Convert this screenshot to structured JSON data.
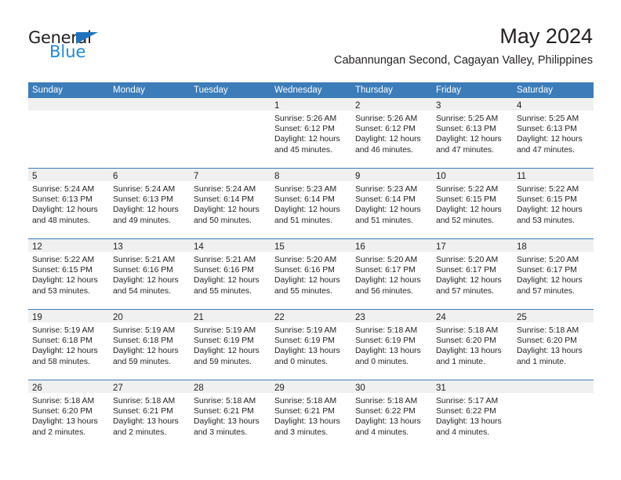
{
  "brand": {
    "name_top": "General",
    "name_bottom": "Blue",
    "triangle_color": "#1f72bd",
    "blue_color": "#1f88e0"
  },
  "header": {
    "title": "May 2024",
    "subtitle": "Cabannungan Second, Cagayan Valley, Philippines"
  },
  "theme": {
    "header_blue": "#3b7cb9",
    "day_band_gray": "#f0f0f0",
    "text_color": "#231f20"
  },
  "weekdays": [
    "Sunday",
    "Monday",
    "Tuesday",
    "Wednesday",
    "Thursday",
    "Friday",
    "Saturday"
  ],
  "weeks": [
    [
      {
        "day": "",
        "empty": true
      },
      {
        "day": "",
        "empty": true
      },
      {
        "day": "",
        "empty": true
      },
      {
        "day": "1",
        "sunrise": "Sunrise: 5:26 AM",
        "sunset": "Sunset: 6:12 PM",
        "daylight1": "Daylight: 12 hours",
        "daylight2": "and 45 minutes."
      },
      {
        "day": "2",
        "sunrise": "Sunrise: 5:26 AM",
        "sunset": "Sunset: 6:12 PM",
        "daylight1": "Daylight: 12 hours",
        "daylight2": "and 46 minutes."
      },
      {
        "day": "3",
        "sunrise": "Sunrise: 5:25 AM",
        "sunset": "Sunset: 6:13 PM",
        "daylight1": "Daylight: 12 hours",
        "daylight2": "and 47 minutes."
      },
      {
        "day": "4",
        "sunrise": "Sunrise: 5:25 AM",
        "sunset": "Sunset: 6:13 PM",
        "daylight1": "Daylight: 12 hours",
        "daylight2": "and 47 minutes."
      }
    ],
    [
      {
        "day": "5",
        "sunrise": "Sunrise: 5:24 AM",
        "sunset": "Sunset: 6:13 PM",
        "daylight1": "Daylight: 12 hours",
        "daylight2": "and 48 minutes."
      },
      {
        "day": "6",
        "sunrise": "Sunrise: 5:24 AM",
        "sunset": "Sunset: 6:13 PM",
        "daylight1": "Daylight: 12 hours",
        "daylight2": "and 49 minutes."
      },
      {
        "day": "7",
        "sunrise": "Sunrise: 5:24 AM",
        "sunset": "Sunset: 6:14 PM",
        "daylight1": "Daylight: 12 hours",
        "daylight2": "and 50 minutes."
      },
      {
        "day": "8",
        "sunrise": "Sunrise: 5:23 AM",
        "sunset": "Sunset: 6:14 PM",
        "daylight1": "Daylight: 12 hours",
        "daylight2": "and 51 minutes."
      },
      {
        "day": "9",
        "sunrise": "Sunrise: 5:23 AM",
        "sunset": "Sunset: 6:14 PM",
        "daylight1": "Daylight: 12 hours",
        "daylight2": "and 51 minutes."
      },
      {
        "day": "10",
        "sunrise": "Sunrise: 5:22 AM",
        "sunset": "Sunset: 6:15 PM",
        "daylight1": "Daylight: 12 hours",
        "daylight2": "and 52 minutes."
      },
      {
        "day": "11",
        "sunrise": "Sunrise: 5:22 AM",
        "sunset": "Sunset: 6:15 PM",
        "daylight1": "Daylight: 12 hours",
        "daylight2": "and 53 minutes."
      }
    ],
    [
      {
        "day": "12",
        "sunrise": "Sunrise: 5:22 AM",
        "sunset": "Sunset: 6:15 PM",
        "daylight1": "Daylight: 12 hours",
        "daylight2": "and 53 minutes."
      },
      {
        "day": "13",
        "sunrise": "Sunrise: 5:21 AM",
        "sunset": "Sunset: 6:16 PM",
        "daylight1": "Daylight: 12 hours",
        "daylight2": "and 54 minutes."
      },
      {
        "day": "14",
        "sunrise": "Sunrise: 5:21 AM",
        "sunset": "Sunset: 6:16 PM",
        "daylight1": "Daylight: 12 hours",
        "daylight2": "and 55 minutes."
      },
      {
        "day": "15",
        "sunrise": "Sunrise: 5:20 AM",
        "sunset": "Sunset: 6:16 PM",
        "daylight1": "Daylight: 12 hours",
        "daylight2": "and 55 minutes."
      },
      {
        "day": "16",
        "sunrise": "Sunrise: 5:20 AM",
        "sunset": "Sunset: 6:17 PM",
        "daylight1": "Daylight: 12 hours",
        "daylight2": "and 56 minutes."
      },
      {
        "day": "17",
        "sunrise": "Sunrise: 5:20 AM",
        "sunset": "Sunset: 6:17 PM",
        "daylight1": "Daylight: 12 hours",
        "daylight2": "and 57 minutes."
      },
      {
        "day": "18",
        "sunrise": "Sunrise: 5:20 AM",
        "sunset": "Sunset: 6:17 PM",
        "daylight1": "Daylight: 12 hours",
        "daylight2": "and 57 minutes."
      }
    ],
    [
      {
        "day": "19",
        "sunrise": "Sunrise: 5:19 AM",
        "sunset": "Sunset: 6:18 PM",
        "daylight1": "Daylight: 12 hours",
        "daylight2": "and 58 minutes."
      },
      {
        "day": "20",
        "sunrise": "Sunrise: 5:19 AM",
        "sunset": "Sunset: 6:18 PM",
        "daylight1": "Daylight: 12 hours",
        "daylight2": "and 59 minutes."
      },
      {
        "day": "21",
        "sunrise": "Sunrise: 5:19 AM",
        "sunset": "Sunset: 6:19 PM",
        "daylight1": "Daylight: 12 hours",
        "daylight2": "and 59 minutes."
      },
      {
        "day": "22",
        "sunrise": "Sunrise: 5:19 AM",
        "sunset": "Sunset: 6:19 PM",
        "daylight1": "Daylight: 13 hours",
        "daylight2": "and 0 minutes."
      },
      {
        "day": "23",
        "sunrise": "Sunrise: 5:18 AM",
        "sunset": "Sunset: 6:19 PM",
        "daylight1": "Daylight: 13 hours",
        "daylight2": "and 0 minutes."
      },
      {
        "day": "24",
        "sunrise": "Sunrise: 5:18 AM",
        "sunset": "Sunset: 6:20 PM",
        "daylight1": "Daylight: 13 hours",
        "daylight2": "and 1 minute."
      },
      {
        "day": "25",
        "sunrise": "Sunrise: 5:18 AM",
        "sunset": "Sunset: 6:20 PM",
        "daylight1": "Daylight: 13 hours",
        "daylight2": "and 1 minute."
      }
    ],
    [
      {
        "day": "26",
        "sunrise": "Sunrise: 5:18 AM",
        "sunset": "Sunset: 6:20 PM",
        "daylight1": "Daylight: 13 hours",
        "daylight2": "and 2 minutes."
      },
      {
        "day": "27",
        "sunrise": "Sunrise: 5:18 AM",
        "sunset": "Sunset: 6:21 PM",
        "daylight1": "Daylight: 13 hours",
        "daylight2": "and 2 minutes."
      },
      {
        "day": "28",
        "sunrise": "Sunrise: 5:18 AM",
        "sunset": "Sunset: 6:21 PM",
        "daylight1": "Daylight: 13 hours",
        "daylight2": "and 3 minutes."
      },
      {
        "day": "29",
        "sunrise": "Sunrise: 5:18 AM",
        "sunset": "Sunset: 6:21 PM",
        "daylight1": "Daylight: 13 hours",
        "daylight2": "and 3 minutes."
      },
      {
        "day": "30",
        "sunrise": "Sunrise: 5:18 AM",
        "sunset": "Sunset: 6:22 PM",
        "daylight1": "Daylight: 13 hours",
        "daylight2": "and 4 minutes."
      },
      {
        "day": "31",
        "sunrise": "Sunrise: 5:17 AM",
        "sunset": "Sunset: 6:22 PM",
        "daylight1": "Daylight: 13 hours",
        "daylight2": "and 4 minutes."
      },
      {
        "day": "",
        "empty": true
      }
    ]
  ]
}
